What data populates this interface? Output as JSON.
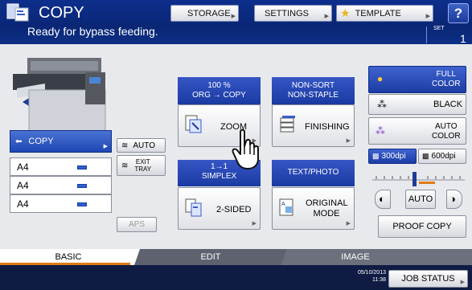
{
  "header": {
    "title": "COPY",
    "status": "Ready for bypass feeding.",
    "set_label": "SET",
    "set_count": "1",
    "buttons": {
      "storage": "STORAGE",
      "settings": "SETTINGS",
      "template": "TEMPLATE",
      "help": "?"
    }
  },
  "paper": {
    "copy_tray_label": "COPY",
    "trays": [
      "A4",
      "A4",
      "A4"
    ],
    "auto_label": "AUTO",
    "exit_tray_label": [
      "EXIT",
      "TRAY"
    ],
    "aps_label": "APS"
  },
  "functions": {
    "zoom": {
      "head": [
        "100 %",
        "ORG  →  COPY"
      ],
      "label": "ZOOM"
    },
    "finishing": {
      "head": [
        "NON-SORT",
        "NON-STAPLE"
      ],
      "label": "FINISHING"
    },
    "duplex": {
      "head": [
        "1→1",
        "SIMPLEX"
      ],
      "label": "2-SIDED"
    },
    "original": {
      "head": [
        "TEXT/PHOTO"
      ],
      "label": [
        "ORIGINAL",
        "MODE"
      ]
    }
  },
  "color": {
    "full": [
      "FULL",
      "COLOR"
    ],
    "black": "BLACK",
    "auto": [
      "AUTO",
      "COLOR"
    ],
    "res_300": "300dpi",
    "res_600": "600dpi",
    "density_auto": "AUTO",
    "density_level": 0.45,
    "proof_copy": "PROOF COPY"
  },
  "tabs": [
    "BASIC",
    "EDIT",
    "IMAGE"
  ],
  "footer": {
    "date": "05/10/2013",
    "time": "11:38",
    "job_status": "JOB STATUS"
  },
  "colors": {
    "header": "#0a2675",
    "accent_blue": "#1a3aa2",
    "active_tab": "#ffffff",
    "tab_underline": "#e07a1a"
  }
}
